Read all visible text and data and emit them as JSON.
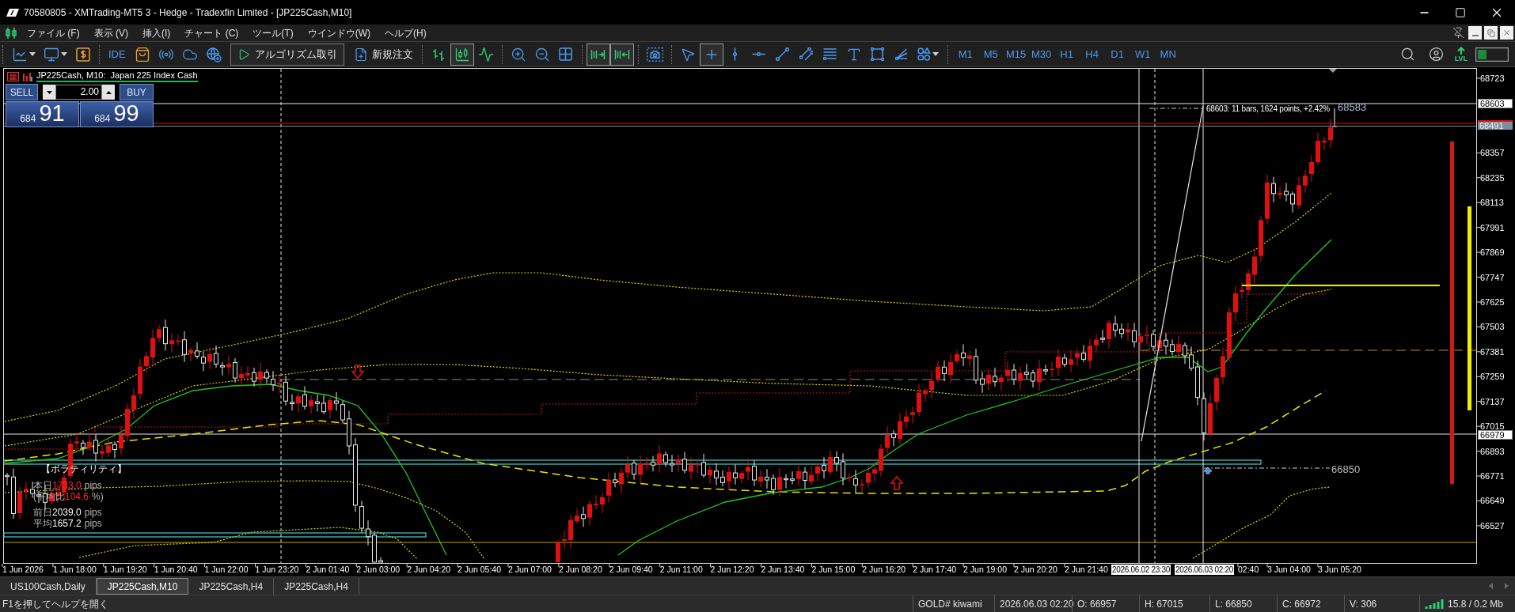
{
  "window": {
    "title": "70580805 - XMTrading-MT5 3 - Hedge - Tradexfin Limited - [JP225Cash,M10]"
  },
  "menu": [
    "ファイル (F)",
    "表示 (V)",
    "挿入(I)",
    "チャート (C)",
    "ツール(T)",
    "ウインドウ(W)",
    "ヘルプ(H)"
  ],
  "toolbar": {
    "groups": [
      {
        "items": [
          {
            "kind": "line-chart-menu"
          },
          {
            "kind": "chart-window-menu"
          },
          {
            "kind": "dollar"
          }
        ]
      },
      {
        "items": [
          {
            "kind": "text",
            "label": "IDE"
          },
          {
            "kind": "bag"
          },
          {
            "kind": "signal"
          },
          {
            "kind": "cloud"
          },
          {
            "kind": "globe-plus"
          },
          {
            "kind": "algo",
            "label": "アルゴリズム取引"
          },
          {
            "kind": "order",
            "label": "新規注文"
          }
        ]
      },
      {
        "items": [
          {
            "kind": "bars",
            "selected": false
          },
          {
            "kind": "candles",
            "selected": true
          },
          {
            "kind": "line",
            "selected": false
          }
        ]
      },
      {
        "items": [
          {
            "kind": "zoom-in"
          },
          {
            "kind": "zoom-out"
          },
          {
            "kind": "grid"
          }
        ]
      },
      {
        "items": [
          {
            "kind": "autoscroll",
            "selected": true
          },
          {
            "kind": "shift",
            "selected": true
          }
        ]
      },
      {
        "items": [
          {
            "kind": "screenshot"
          }
        ]
      },
      {
        "items": [
          {
            "kind": "cursor",
            "selected": false
          },
          {
            "kind": "crosshair",
            "selected": true
          },
          {
            "kind": "vline",
            "selected": false
          },
          {
            "kind": "hline",
            "selected": false
          },
          {
            "kind": "trendline",
            "selected": false
          },
          {
            "kind": "channel",
            "selected": false
          },
          {
            "kind": "fibo",
            "selected": false
          },
          {
            "kind": "text-tool",
            "selected": false
          },
          {
            "kind": "rectangle",
            "selected": false
          },
          {
            "kind": "arrows",
            "selected": false
          },
          {
            "kind": "shapes-menu",
            "selected": false
          }
        ]
      }
    ],
    "timeframes": [
      {
        "label": "M1",
        "selected": false
      },
      {
        "label": "M5",
        "selected": false
      },
      {
        "label": "M15",
        "selected": false
      },
      {
        "label": "M30",
        "selected": false
      },
      {
        "label": "H1",
        "selected": false
      },
      {
        "label": "H4",
        "selected": false
      },
      {
        "label": "D1",
        "selected": false
      },
      {
        "label": "W1",
        "selected": false
      },
      {
        "label": "MN",
        "selected": false
      }
    ],
    "lvl": "LVL"
  },
  "chart": {
    "legend": "JP225Cash, M10:  Japan 225 Index Cash",
    "trade_panel": {
      "sell_label": "SELL",
      "buy_label": "BUY",
      "volume": "2.00",
      "sell_price": {
        "big": "684",
        "small": "91"
      },
      "buy_price": {
        "big": "684",
        "small": "99"
      }
    },
    "measure_label": "68603: 11 bars, 1624 points, +2.42%",
    "crosshair_price": "68583",
    "level_label": "66850",
    "volatility": {
      "title": "【ボラティリティ】",
      "rows": [
        {
          "label": "本日",
          "value": "1733.0",
          "unit": "pips",
          "alert": true
        },
        {
          "label": "(平均比",
          "value": "104.6",
          "unit": "%)",
          "alert": true
        },
        {
          "label": "前日",
          "value": "2039.0",
          "unit": "pips",
          "alert": false
        },
        {
          "label": "平均",
          "value": "1657.2",
          "unit": "pips",
          "alert": false
        }
      ]
    },
    "price_axis": {
      "ticks": [
        "68723",
        "68357",
        "68235",
        "68113",
        "67991",
        "67869",
        "67747",
        "67625",
        "67503",
        "67381",
        "67259",
        "67137",
        "67015",
        "66893",
        "66771",
        "66649",
        "66527"
      ],
      "markers": [
        {
          "label": "68603",
          "kind": "line"
        },
        {
          "label": "68491",
          "kind": "bid"
        },
        {
          "label": "66979",
          "kind": "line"
        }
      ]
    },
    "time_axis": [
      {
        "label": "1 Jun 2026",
        "kind": "tick"
      },
      {
        "label": "1 Jun 18:00",
        "kind": "tick"
      },
      {
        "label": "1 Jun 19:20",
        "kind": "tick"
      },
      {
        "label": "1 Jun 20:40",
        "kind": "tick"
      },
      {
        "label": "1 Jun 22:00",
        "kind": "tick"
      },
      {
        "label": "1 Jun 23:20",
        "kind": "tick"
      },
      {
        "label": "2 Jun 01:40",
        "kind": "tick"
      },
      {
        "label": "2 Jun 03:00",
        "kind": "tick"
      },
      {
        "label": "2 Jun 04:20",
        "kind": "tick"
      },
      {
        "label": "2 Jun 05:40",
        "kind": "tick"
      },
      {
        "label": "2 Jun 07:00",
        "kind": "tick"
      },
      {
        "label": "2 Jun 08:20",
        "kind": "tick"
      },
      {
        "label": "2 Jun 09:40",
        "kind": "tick"
      },
      {
        "label": "2 Jun 11:00",
        "kind": "tick"
      },
      {
        "label": "2 Jun 12:20",
        "kind": "tick"
      },
      {
        "label": "2 Jun 13:40",
        "kind": "tick"
      },
      {
        "label": "2 Jun 15:00",
        "kind": "tick"
      },
      {
        "label": "2 Jun 16:20",
        "kind": "tick"
      },
      {
        "label": "2 Jun 17:40",
        "kind": "tick"
      },
      {
        "label": "2 Jun 19:00",
        "kind": "tick"
      },
      {
        "label": "2 Jun 20:20",
        "kind": "tick"
      },
      {
        "label": "2 Jun 21:40",
        "kind": "tick"
      },
      {
        "label": "2026.06.02 23:30",
        "kind": "cursor"
      },
      {
        "label": "2026.06.03 02:20",
        "kind": "cursor"
      },
      {
        "label": "02:40",
        "kind": "tick"
      },
      {
        "label": "3 Jun 04:00",
        "kind": "tick"
      },
      {
        "label": "3 Jun 05:20",
        "kind": "tick"
      }
    ]
  },
  "tabs": [
    {
      "label": "US100Cash,Daily",
      "selected": false
    },
    {
      "label": "JP225Cash,M10",
      "selected": true
    },
    {
      "label": "JP225Cash,H4",
      "selected": false
    },
    {
      "label": "JP225Cash,H4",
      "selected": false
    }
  ],
  "status_bar": {
    "help": "F1を押してヘルプを開く",
    "fields": [
      "GOLD# kiwami",
      "2026.06.03 02:20",
      "O: 66957",
      "H: 67015",
      "L: 66850",
      "C: 66972",
      "V: 306"
    ],
    "memory": "15.8 / 0.2 Mb"
  }
}
